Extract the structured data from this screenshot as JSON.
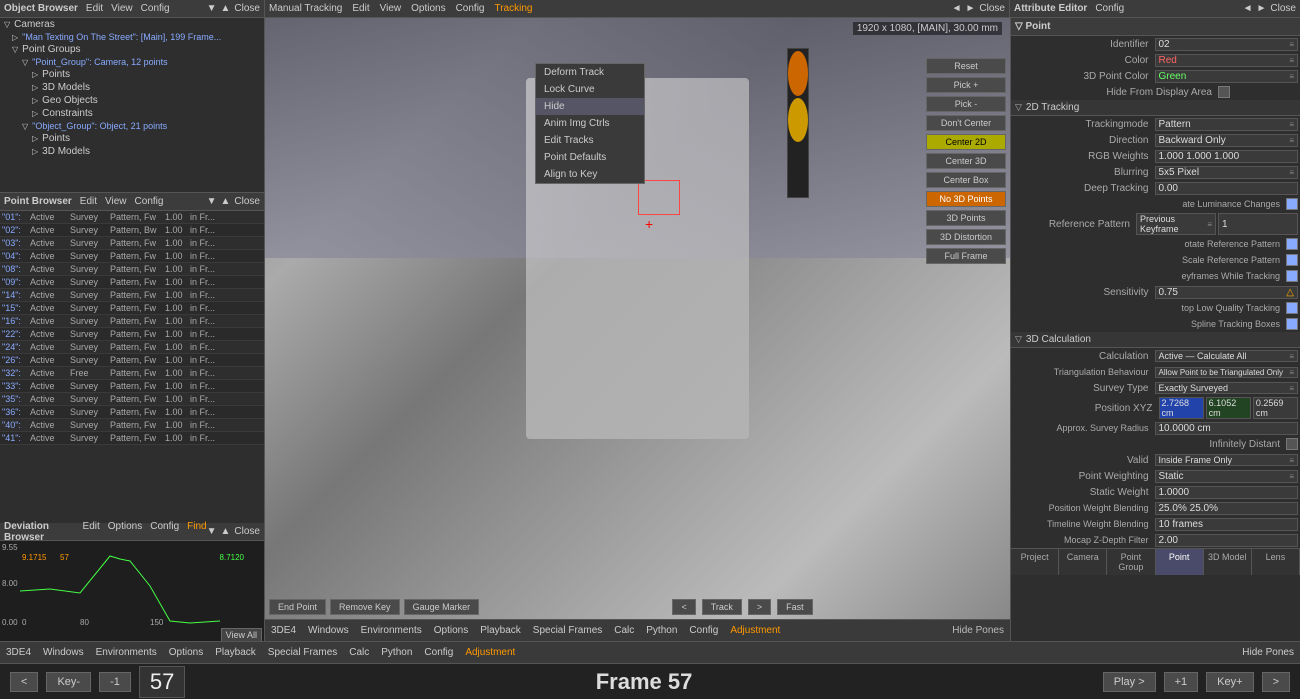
{
  "app": {
    "title": "3DE4",
    "top_menus": [
      "Object Browser",
      "Edit",
      "View",
      "Config",
      "▼",
      "▲",
      "Close"
    ],
    "tracking_menus": [
      "Manual Tracking",
      "Edit",
      "View",
      "Options",
      "Config",
      "Tracking"
    ],
    "attr_menus": [
      "Attribute Editor",
      "Config",
      "◄",
      "►",
      "Close"
    ]
  },
  "object_browser": {
    "title": "Object Browser",
    "items": [
      {
        "label": "Cameras",
        "indent": 0,
        "expanded": true
      },
      {
        "label": "\"Man Texting On The Street\": [Main], 199 Frame...",
        "indent": 1,
        "expanded": false
      },
      {
        "label": "Point Groups",
        "indent": 1,
        "expanded": true
      },
      {
        "label": "\"Point_Group\": Camera, 12 points",
        "indent": 2,
        "expanded": true
      },
      {
        "label": "Points",
        "indent": 3
      },
      {
        "label": "3D Models",
        "indent": 3
      },
      {
        "label": "Geo Objects",
        "indent": 3
      },
      {
        "label": "Constraints",
        "indent": 3
      },
      {
        "label": "\"Object_Group\": Object, 21 points",
        "indent": 2,
        "expanded": true
      },
      {
        "label": "Points",
        "indent": 3
      },
      {
        "label": "3D Models",
        "indent": 3
      }
    ]
  },
  "point_browser": {
    "title": "Point Browser",
    "menus": [
      "Edit",
      "View",
      "Config"
    ],
    "rows": [
      {
        "id": "\"01\":",
        "status": "Active",
        "type": "Survey",
        "mode": "Pattern, Fw",
        "val": "1.00",
        "frame": "in Fr..."
      },
      {
        "id": "\"02\":",
        "status": "Active",
        "type": "Survey",
        "mode": "Pattern, Bw",
        "val": "1.00",
        "frame": "in Fr..."
      },
      {
        "id": "\"03\":",
        "status": "Active",
        "type": "Survey",
        "mode": "Pattern, Fw",
        "val": "1.00",
        "frame": "in Fr..."
      },
      {
        "id": "\"04\":",
        "status": "Active",
        "type": "Survey",
        "mode": "Pattern, Fw",
        "val": "1.00",
        "frame": "in Fr..."
      },
      {
        "id": "\"08\":",
        "status": "Active",
        "type": "Survey",
        "mode": "Pattern, Fw",
        "val": "1.00",
        "frame": "in Fr..."
      },
      {
        "id": "\"09\":",
        "status": "Active",
        "type": "Survey",
        "mode": "Pattern, Fw",
        "val": "1.00",
        "frame": "in Fr..."
      },
      {
        "id": "\"14\":",
        "status": "Active",
        "type": "Survey",
        "mode": "Pattern, Fw",
        "val": "1.00",
        "frame": "in Fr..."
      },
      {
        "id": "\"15\":",
        "status": "Active",
        "type": "Survey",
        "mode": "Pattern, Fw",
        "val": "1.00",
        "frame": "in Fr..."
      },
      {
        "id": "\"16\":",
        "status": "Active",
        "type": "Survey",
        "mode": "Pattern, Fw",
        "val": "1.00",
        "frame": "in Fr..."
      },
      {
        "id": "\"22\":",
        "status": "Active",
        "type": "Survey",
        "mode": "Pattern, Fw",
        "val": "1.00",
        "frame": "in Fr..."
      },
      {
        "id": "\"24\":",
        "status": "Active",
        "type": "Survey",
        "mode": "Pattern, Fw",
        "val": "1.00",
        "frame": "in Fr..."
      },
      {
        "id": "\"26\":",
        "status": "Active",
        "type": "Survey",
        "mode": "Pattern, Fw",
        "val": "1.00",
        "frame": "in Fr..."
      },
      {
        "id": "\"32\":",
        "status": "Active",
        "type": "Free",
        "mode": "Pattern, Fw",
        "val": "1.00",
        "frame": "in Fr..."
      },
      {
        "id": "\"33\":",
        "status": "Active",
        "type": "Survey",
        "mode": "Pattern, Fw",
        "val": "1.00",
        "frame": "in Fr..."
      },
      {
        "id": "\"35\":",
        "status": "Active",
        "type": "Survey",
        "mode": "Pattern, Fw",
        "val": "1.00",
        "frame": "in Fr..."
      },
      {
        "id": "\"36\":",
        "status": "Active",
        "type": "Survey",
        "mode": "Pattern, Fw",
        "val": "1.00",
        "frame": "in Fr..."
      },
      {
        "id": "\"40\":",
        "status": "Active",
        "type": "Survey",
        "mode": "Pattern, Fw",
        "val": "1.00",
        "frame": "in Fr..."
      },
      {
        "id": "\"41\":",
        "status": "Active",
        "type": "Survey",
        "mode": "Pattern, Fw",
        "val": "1.00",
        "frame": "in Fr..."
      }
    ]
  },
  "viewport": {
    "info": "1920 x 1080, [MAIN], 30.00 mm",
    "frame": "Frame 57"
  },
  "context_menu": {
    "items": [
      "Deform Track",
      "Lock Curve",
      "Hide",
      "Anim Img Ctrls",
      "Edit Tracks",
      "Point Defaults",
      "Align to Key"
    ],
    "highlighted": "Hide"
  },
  "right_buttons": [
    {
      "label": "Reset",
      "type": "normal"
    },
    {
      "label": "Pick +",
      "type": "normal"
    },
    {
      "label": "Pick -",
      "type": "normal"
    },
    {
      "label": "Don't Center",
      "type": "normal"
    },
    {
      "label": "Center 2D",
      "type": "active"
    },
    {
      "label": "Center 3D",
      "type": "normal"
    },
    {
      "label": "Center Box",
      "type": "normal"
    },
    {
      "label": "No 3D Points",
      "type": "orange"
    },
    {
      "label": "3D Points",
      "type": "normal"
    },
    {
      "label": "3D Distortion",
      "type": "normal"
    },
    {
      "label": "Full Frame",
      "type": "normal"
    }
  ],
  "bottom_controls": {
    "left": [
      "End Point",
      "Remove Key",
      "Gauge Marker"
    ],
    "center": [
      "<",
      "Track",
      ">",
      "Fast"
    ],
    "right": []
  },
  "deviation_browser": {
    "title": "Deviation Browser",
    "menus": [
      "Edit",
      "Options",
      "Config",
      "Find"
    ],
    "y_labels": [
      "9.55",
      "8.00",
      "0.00"
    ],
    "x_labels": [
      "0",
      "80",
      "150"
    ],
    "values": [
      "9.1715",
      "57",
      "8.7120"
    ]
  },
  "attribute_editor": {
    "title": "Point",
    "identifier": "02",
    "color": "Red",
    "point_color_3d": "Green",
    "hide_from_display": "",
    "tracking_2d": {
      "trackingmode": "Pattern",
      "direction": "Backward Only",
      "rgb_weights": "1.000 1.000 1.000",
      "blurring": "5x5 Pixel",
      "deep_tracking": "0.00",
      "adapt_luminance": true,
      "reference_pattern": "Previous Keyframe",
      "ref_pattern_val": "1",
      "rotate_ref": true,
      "scale_ref": true,
      "keyframes_while_tracking": true,
      "sensitivity": "0.75",
      "sensitivity_warn": true,
      "stop_low_quality": true,
      "spline_tracking_boxes": true
    },
    "calc_3d": {
      "calculation": "Active — Calculate All",
      "triangulation": "Allow Point to be Triangulated Only",
      "survey_type": "Exactly Surveyed",
      "position_xyz": [
        "2.7268 cm",
        "6.1052 cm",
        "0.2569 cm"
      ],
      "approx_survey_radius": "10.0000 cm",
      "infinitely_distant": "",
      "valid": "Inside Frame Only",
      "point_weighting": "Static",
      "static_weight": "1.0000",
      "position_weight_blending": "25.0%  25.0%",
      "timeline_weight_blending": "10 frames",
      "mocap_z_depth_filter": "2.00"
    },
    "tabs": [
      "Project",
      "Camera",
      "Point Group",
      "Point",
      "3D Model",
      "Lens"
    ],
    "active_tab": "Point"
  },
  "bottom_bar": {
    "menus": [
      "3DE4",
      "Windows",
      "Environments",
      "Options",
      "Playback",
      "Special Frames",
      "Calc",
      "Python",
      "Config",
      "Adjustment"
    ],
    "active": "Adjustment"
  },
  "footer": {
    "key_minus": "Key-",
    "minus1": "-1",
    "frame_number": "57",
    "frame_label": "Frame 57",
    "play_label": "Play >",
    "plus1": "+1",
    "key_plus": "Key+"
  }
}
